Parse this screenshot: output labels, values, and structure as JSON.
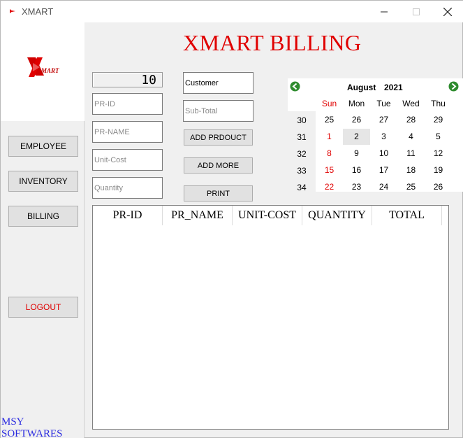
{
  "window": {
    "title": "XMART"
  },
  "sidebar": {
    "buttons": [
      {
        "label": "EMPLOYEE"
      },
      {
        "label": "INVENTORY"
      },
      {
        "label": "BILLING"
      },
      {
        "label": "LOGOUT"
      }
    ],
    "footer": "MSY SOFTWARES"
  },
  "header": {
    "title": "XMART BILLING"
  },
  "lcd": {
    "value": "10"
  },
  "form": {
    "pr_id": {
      "placeholder": "PR-ID",
      "value": ""
    },
    "pr_name": {
      "placeholder": "PR-NAME",
      "value": ""
    },
    "unit_cost": {
      "placeholder": "Unit-Cost",
      "value": ""
    },
    "quantity": {
      "placeholder": "Quantity",
      "value": ""
    },
    "customer": {
      "placeholder": "",
      "value": "Customer"
    },
    "subtotal": {
      "placeholder": "Sub-Total",
      "value": ""
    }
  },
  "actions": {
    "add_product": "ADD PRDOUCT",
    "add_more": "ADD MORE",
    "print": "PRINT"
  },
  "calendar": {
    "month": "August",
    "year": "2021",
    "days_of_week": [
      "Sun",
      "Mon",
      "Tue",
      "Wed",
      "Thu"
    ],
    "weeks": [
      {
        "week": "30",
        "days": [
          "25",
          "26",
          "27",
          "28",
          "29"
        ]
      },
      {
        "week": "31",
        "days": [
          "1",
          "2",
          "3",
          "4",
          "5"
        ]
      },
      {
        "week": "32",
        "days": [
          "8",
          "9",
          "10",
          "11",
          "12"
        ]
      },
      {
        "week": "33",
        "days": [
          "15",
          "16",
          "17",
          "18",
          "19"
        ]
      },
      {
        "week": "34",
        "days": [
          "22",
          "23",
          "24",
          "25",
          "26"
        ]
      }
    ],
    "selected_day": "2",
    "nav_color": "#2e8b2e",
    "weekend_color": "#e00000"
  },
  "table": {
    "columns": [
      "PR-ID",
      "PR_NAME",
      "UNIT-COST",
      "QUANTITY",
      "TOTAL"
    ],
    "rows": []
  },
  "colors": {
    "accent_red": "#e00000",
    "footer_blue": "#2a2ae0"
  }
}
